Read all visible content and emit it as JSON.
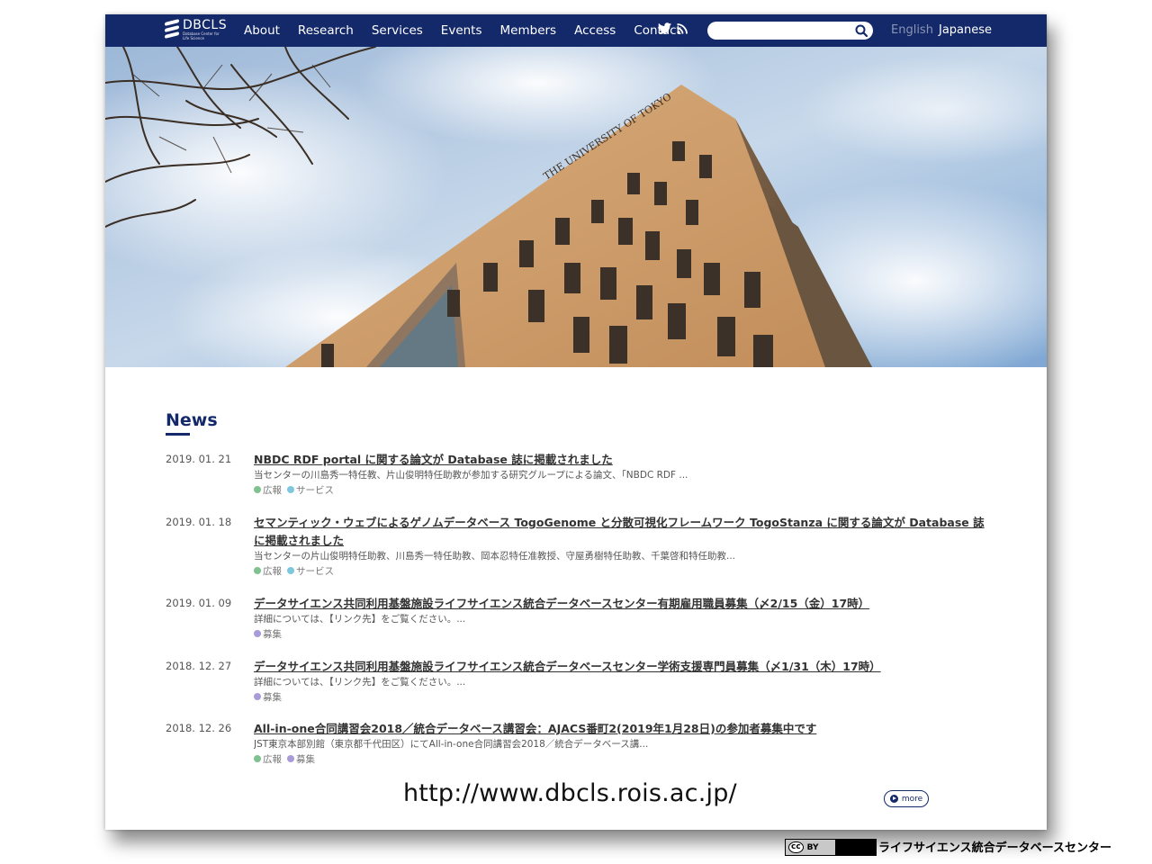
{
  "nav": {
    "logo_name": "DBCLS",
    "logo_sub": "Database Center for Life Science",
    "links": [
      "About",
      "Research",
      "Services",
      "Events",
      "Members",
      "Access",
      "Contact"
    ],
    "search_placeholder": "",
    "lang_english": "English",
    "lang_japanese": "Japanese"
  },
  "hero": {
    "building_sign": "THE UNIVERSITY OF TOKYO"
  },
  "news": {
    "heading": "News",
    "items": [
      {
        "date": "2019. 01. 21",
        "title": "NBDC RDF portal に関する論文が Database 誌に掲載されました",
        "summary": "当センターの川島秀一特任教、片山俊明特任助教が参加する研究グループによる論文、「NBDC RDF ...",
        "tags": [
          "広報",
          "サービス"
        ]
      },
      {
        "date": "2019. 01. 18",
        "title": "セマンティック・ウェブによるゲノムデータベース TogoGenome と分散可視化フレームワーク TogoStanza に関する論文が Database 誌に掲載されました",
        "summary": "当センターの片山俊明特任助教、川島秀一特任助教、岡本忍特任准教授、守屋勇樹特任助教、千葉啓和特任助教...",
        "tags": [
          "広報",
          "サービス"
        ]
      },
      {
        "date": "2019. 01. 09",
        "title": "データサイエンス共同利用基盤施設ライフサイエンス統合データベースセンター有期雇用職員募集（〆2/15（金）17時）",
        "summary": "詳細については、【リンク先】をご覧ください。...",
        "tags": [
          "募集"
        ]
      },
      {
        "date": "2018. 12. 27",
        "title": "データサイエンス共同利用基盤施設ライフサイエンス統合データベースセンター学術支援専門員募集（〆1/31（木）17時）",
        "summary": "詳細については、【リンク先】をご覧ください。...",
        "tags": [
          "募集"
        ]
      },
      {
        "date": "2018. 12. 26",
        "title": "All-in-one合同講習会2018／統合データベース講習会：AJACS番町2(2019年1月28日)の参加者募集中です",
        "summary": "JST東京本部別館（東京都千代田区）にてAll-in-one合同講習会2018／統合データベース講...",
        "tags": [
          "広報",
          "募集"
        ]
      }
    ],
    "more_label": "more"
  },
  "url_caption": "http://www.dbcls.rois.ac.jp/",
  "footer": {
    "cc_label": "cc",
    "cc_by": "BY",
    "org_name": "ライフサイエンス統合データベースセンター"
  },
  "colors": {
    "nav_bg": "#14296a",
    "tag_koho": "#7fc28f",
    "tag_service": "#7ec8dd",
    "tag_boshu": "#a99bd8"
  }
}
